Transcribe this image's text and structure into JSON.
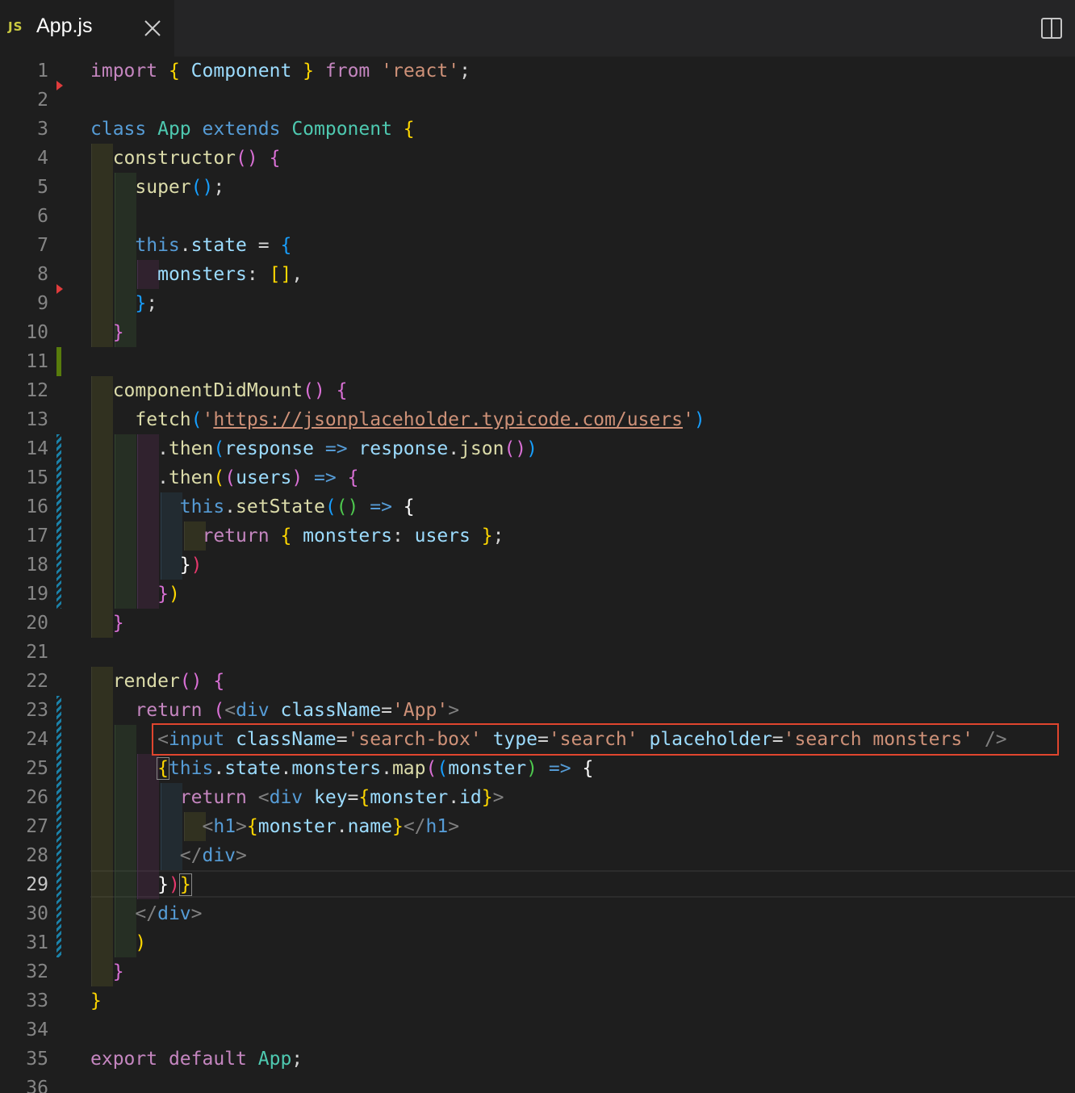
{
  "tab": {
    "icon_label": "JS",
    "title": "App.js",
    "close_icon": "close-icon"
  },
  "toolbar": {
    "split_icon": "split-editor-icon"
  },
  "editor": {
    "active_line": 29,
    "line_numbers": [
      "1",
      "2",
      "3",
      "4",
      "5",
      "6",
      "7",
      "8",
      "9",
      "10",
      "11",
      "12",
      "13",
      "14",
      "15",
      "16",
      "17",
      "18",
      "19",
      "20",
      "21",
      "22",
      "23",
      "24",
      "25",
      "26",
      "27",
      "28",
      "29",
      "30",
      "31",
      "32",
      "33",
      "34",
      "35",
      "36"
    ],
    "code": {
      "l1": {
        "t1": "import",
        "t2": " ",
        "t3": "{",
        "t4": " ",
        "t5": "Component",
        "t6": " ",
        "t7": "}",
        "t8": " ",
        "t9": "from",
        "t10": " ",
        "t11": "'react'",
        "t12": ";"
      },
      "l3": {
        "t1": "class",
        "t2": " ",
        "t3": "App",
        "t4": " ",
        "t5": "extends",
        "t6": " ",
        "t7": "Component",
        "t8": " ",
        "t9": "{"
      },
      "l4": {
        "t1": "  ",
        "t2": "constructor",
        "t3": "()",
        "t4": " ",
        "t5": "{"
      },
      "l5": {
        "t1": "    ",
        "t2": "super",
        "t3": "()",
        "t4": ";"
      },
      "l7": {
        "t1": "    ",
        "t2": "this",
        "t3": ".",
        "t4": "state",
        "t5": " = ",
        "t6": "{"
      },
      "l8": {
        "t1": "      ",
        "t2": "monsters",
        "t3": ": ",
        "t4": "[]",
        "t5": ","
      },
      "l9": {
        "t1": "    ",
        "t2": "}",
        "t3": ";"
      },
      "l10": {
        "t1": "  ",
        "t2": "}"
      },
      "l12": {
        "t1": "  ",
        "t2": "componentDidMount",
        "t3": "()",
        "t4": " ",
        "t5": "{"
      },
      "l13": {
        "t1": "    ",
        "t2": "fetch",
        "t3": "(",
        "t4": "'",
        "t5": "https://jsonplaceholder.typicode.com/users",
        "t6": "'",
        "t7": ")"
      },
      "l14": {
        "t1": "      ",
        "t2": ".",
        "t3": "then",
        "t4": "(",
        "t5": "response",
        "t6": " ",
        "t7": "=>",
        "t8": " ",
        "t9": "response",
        "t10": ".",
        "t11": "json",
        "t12": "()",
        "t13": ")"
      },
      "l15": {
        "t1": "      ",
        "t2": ".",
        "t3": "then",
        "t4": "(",
        "t5": "(",
        "t6": "users",
        "t7": ")",
        "t8": " ",
        "t9": "=>",
        "t10": " ",
        "t11": "{"
      },
      "l16": {
        "t1": "        ",
        "t2": "this",
        "t3": ".",
        "t4": "setState",
        "t5": "(",
        "t6": "()",
        "t7": " ",
        "t8": "=>",
        "t9": " ",
        "t10": "{"
      },
      "l17": {
        "t1": "          ",
        "t2": "return",
        "t3": " ",
        "t4": "{",
        "t5": " ",
        "t6": "monsters",
        "t7": ": ",
        "t8": "users",
        "t9": " ",
        "t10": "}",
        "t11": ";"
      },
      "l18": {
        "t1": "        ",
        "t2": "}",
        "t3": ")"
      },
      "l19": {
        "t1": "      ",
        "t2": "}",
        "t3": ")"
      },
      "l20": {
        "t1": "  ",
        "t2": "}"
      },
      "l22": {
        "t1": "  ",
        "t2": "render",
        "t3": "()",
        "t4": " ",
        "t5": "{"
      },
      "l23": {
        "t1": "    ",
        "t2": "return",
        "t3": " ",
        "t4": "(",
        "t5": "<",
        "t6": "div",
        "t7": " ",
        "t8": "className",
        "t9": "=",
        "t10": "'App'",
        "t11": ">"
      },
      "l24": {
        "t1": "      ",
        "t2": "<",
        "t3": "input",
        "t4": " ",
        "t5": "className",
        "t6": "=",
        "t7": "'search-box'",
        "t8": " ",
        "t9": "type",
        "t10": "=",
        "t11": "'search'",
        "t12": " ",
        "t13": "placeholder",
        "t14": "=",
        "t15": "'search monsters'",
        "t16": " ",
        "t17": "/>"
      },
      "l25": {
        "t1": "      ",
        "t2": "{",
        "t3": "this",
        "t4": ".",
        "t5": "state",
        "t6": ".",
        "t7": "monsters",
        "t8": ".",
        "t9": "map",
        "t10": "(",
        "t11": "(",
        "t12": "monster",
        "t13": ")",
        "t14": " ",
        "t15": "=>",
        "t16": " ",
        "t17": "{"
      },
      "l26": {
        "t1": "        ",
        "t2": "return",
        "t3": " ",
        "t4": "<",
        "t5": "div",
        "t6": " ",
        "t7": "key",
        "t8": "=",
        "t9": "{",
        "t10": "monster",
        "t11": ".",
        "t12": "id",
        "t13": "}",
        "t14": ">"
      },
      "l27": {
        "t1": "          ",
        "t2": "<",
        "t3": "h1",
        "t4": ">",
        "t5": "{",
        "t6": "monster",
        "t7": ".",
        "t8": "name",
        "t9": "}",
        "t10": "</",
        "t11": "h1",
        "t12": ">"
      },
      "l28": {
        "t1": "        ",
        "t2": "</",
        "t3": "div",
        "t4": ">"
      },
      "l29": {
        "t1": "      ",
        "t2": "}",
        "t3": ")",
        "t4": "}"
      },
      "l30": {
        "t1": "    ",
        "t2": "</",
        "t3": "div",
        "t4": ">"
      },
      "l31": {
        "t1": "    ",
        "t2": ")"
      },
      "l32": {
        "t1": "  ",
        "t2": "}"
      },
      "l33": {
        "t1": "}"
      },
      "l35": {
        "t1": "export",
        "t2": " ",
        "t3": "default",
        "t4": " ",
        "t5": "App",
        "t6": ";"
      }
    }
  },
  "colors": {
    "background": "#1e1e1e",
    "highlight_box": "#e0452e",
    "git_added": "#587c0c",
    "git_modified": "#1b81a8",
    "git_deleted": "#e03c3c"
  }
}
